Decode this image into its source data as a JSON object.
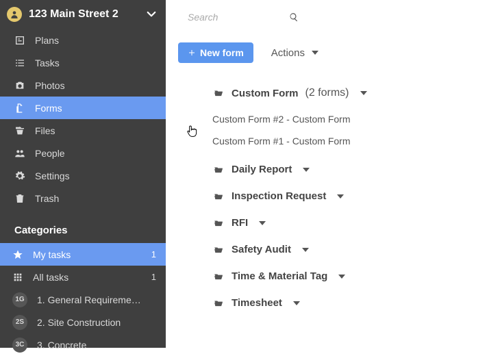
{
  "project": {
    "name": "123 Main Street 2"
  },
  "search": {
    "placeholder": "Search"
  },
  "toolbar": {
    "new_form": "New form",
    "actions": "Actions"
  },
  "nav": {
    "items": [
      {
        "label": "Plans",
        "icon": "plans-icon"
      },
      {
        "label": "Tasks",
        "icon": "tasks-icon"
      },
      {
        "label": "Photos",
        "icon": "photos-icon"
      },
      {
        "label": "Forms",
        "icon": "forms-icon",
        "active": true
      },
      {
        "label": "Files",
        "icon": "files-icon"
      },
      {
        "label": "People",
        "icon": "people-icon"
      },
      {
        "label": "Settings",
        "icon": "settings-icon"
      },
      {
        "label": "Trash",
        "icon": "trash-icon"
      }
    ],
    "section_header": "Categories",
    "categories": [
      {
        "label": "My tasks",
        "icon": "star-icon",
        "count": "1",
        "active": true
      },
      {
        "label": "All tasks",
        "icon": "grid-icon",
        "count": "1"
      },
      {
        "label": "1. General Requireme…",
        "badge": "1G"
      },
      {
        "label": "2. Site Construction",
        "badge": "2S"
      },
      {
        "label": "3. Concrete",
        "badge": "3C"
      }
    ]
  },
  "folders": [
    {
      "name": "Custom Form",
      "suffix": "(2 forms)",
      "expanded": true,
      "forms": [
        "Custom Form #2 - Custom Form",
        "Custom Form #1 - Custom Form"
      ]
    },
    {
      "name": "Daily Report"
    },
    {
      "name": "Inspection Request"
    },
    {
      "name": "RFI"
    },
    {
      "name": "Safety Audit"
    },
    {
      "name": "Time & Material Tag"
    },
    {
      "name": "Timesheet"
    }
  ]
}
